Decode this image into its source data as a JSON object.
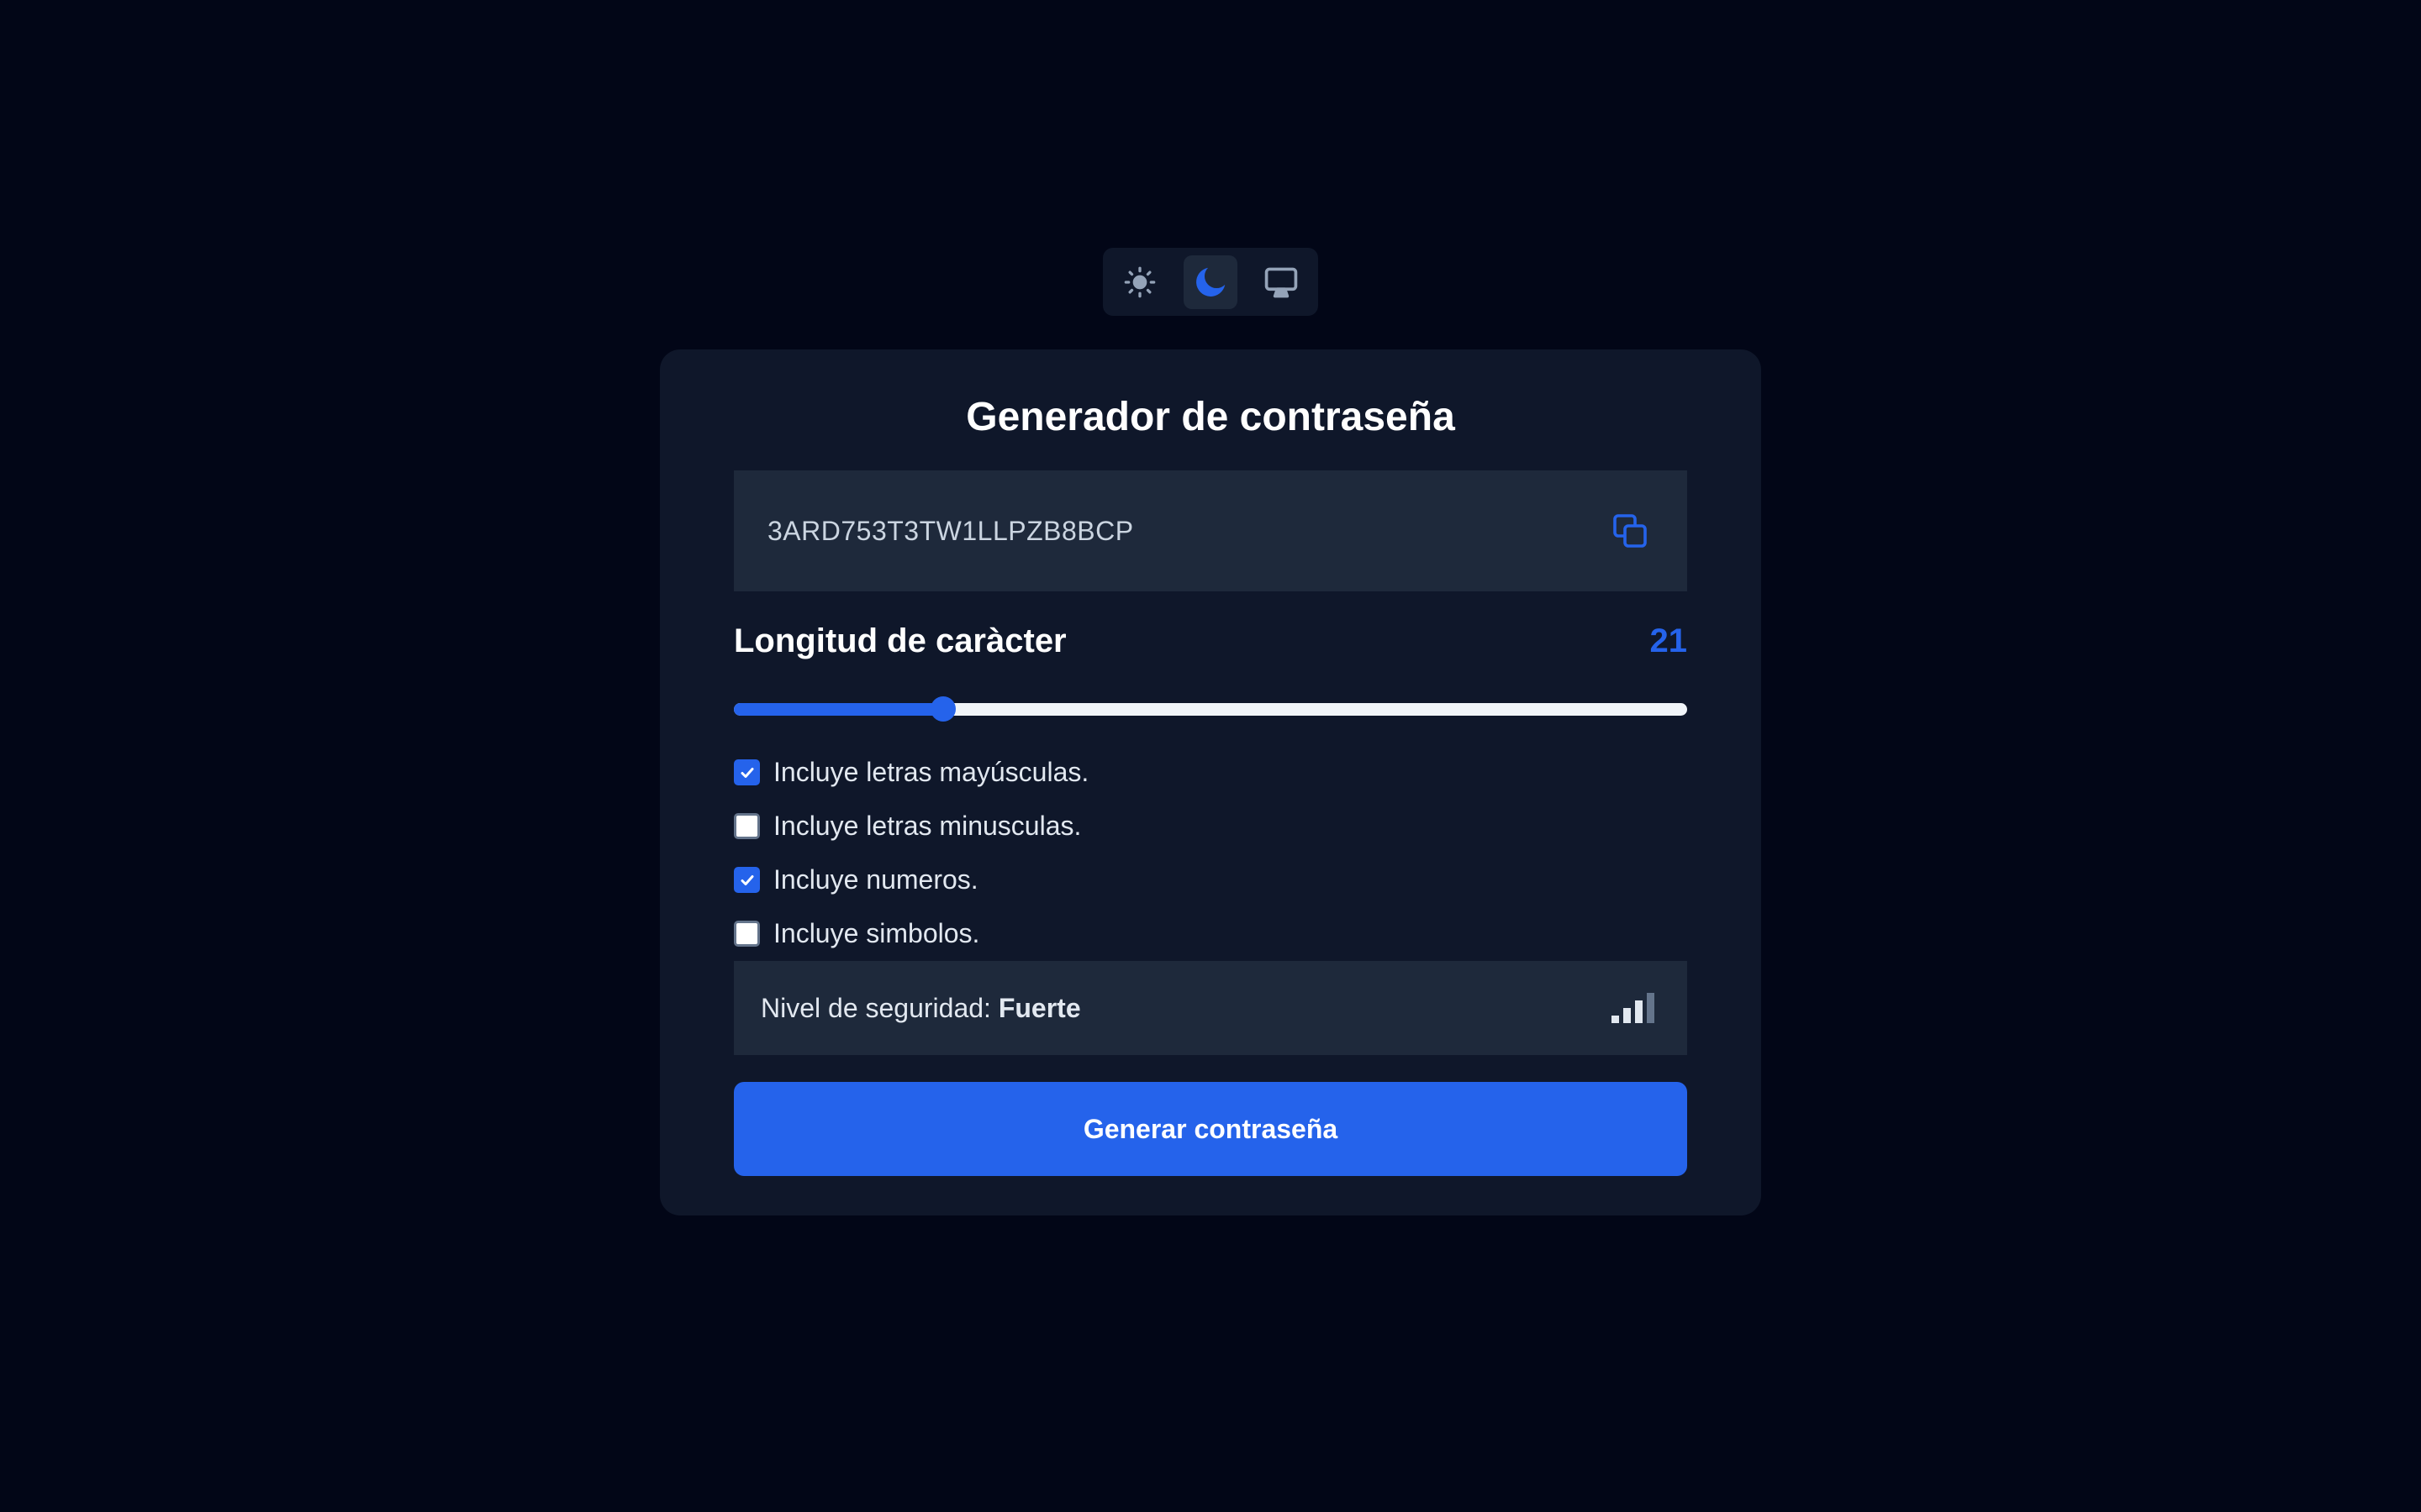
{
  "theme_switch": {
    "options": [
      {
        "name": "light",
        "icon": "sun-icon",
        "active": false
      },
      {
        "name": "dark",
        "icon": "moon-icon",
        "active": true
      },
      {
        "name": "system",
        "icon": "monitor-icon",
        "active": false
      }
    ]
  },
  "card": {
    "title": "Generador de contraseña",
    "password": "3ARD753T3TW1LLPZB8BCP",
    "copy_icon": "copy-icon",
    "length": {
      "label": "Longitud de caràcter",
      "value": "21",
      "slider_fraction": 0.22
    },
    "options": [
      {
        "label": "Incluye letras mayúsculas.",
        "checked": true
      },
      {
        "label": "Incluye letras minusculas.",
        "checked": false
      },
      {
        "label": "Incluye numeros.",
        "checked": true
      },
      {
        "label": "Incluye simbolos.",
        "checked": false
      }
    ],
    "security": {
      "label": "Nivel de seguridad:",
      "level": "Fuerte",
      "bars_filled": 3,
      "bars_total": 4,
      "icon": "signal-strength-icon"
    },
    "generate_label": "Generar contraseña"
  },
  "colors": {
    "background": "#020617",
    "card": "#0f172a",
    "field": "#1e293b",
    "accent": "#2563eb",
    "text": "#e2e8f0"
  }
}
